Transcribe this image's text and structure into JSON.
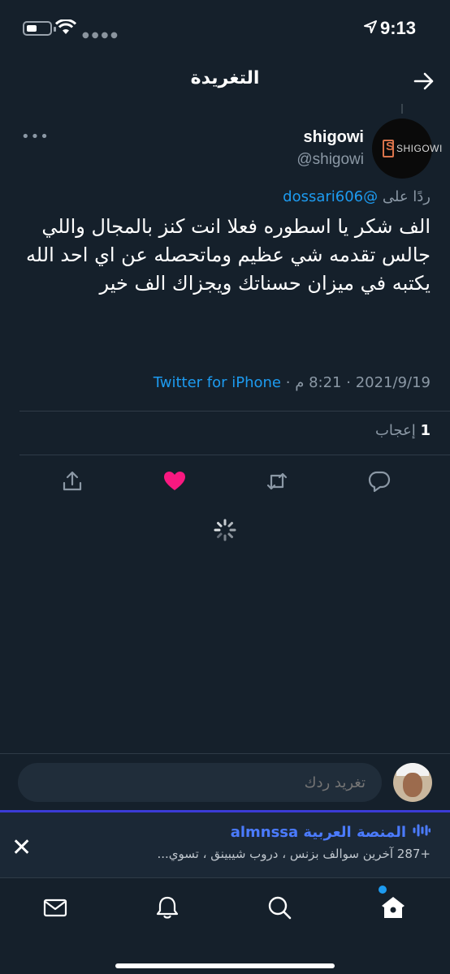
{
  "status_bar": {
    "time": "9:13"
  },
  "header": {
    "title": "التغريدة"
  },
  "tweet": {
    "author_name": "shigowi",
    "author_handle": "@shigowi",
    "avatar_text": "SHIGOWI",
    "avatar_letter": "S",
    "reply_to_prefix": "ردًا على ",
    "reply_to_handle": "@dossari606",
    "text": "الف شكر يا اسطوره فعلا انت كنز بالمجال واللي جالس تقدمه شي عظيم وماتحصله عن اي احد الله يكتبه في ميزان حسناتك ويجزاك الف خير",
    "date": "2021/9/19",
    "separator": "·",
    "time": "8:21 م",
    "source": "Twitter for iPhone",
    "likes_count": "1",
    "likes_label": "إعجاب"
  },
  "reply": {
    "placeholder": "تغريد ردك"
  },
  "spaces": {
    "title": "المنصة العربية almnssa",
    "subtitle": "+287 آخرين  سوالف بزنس ، دروب شيبينق ، تسوي..."
  },
  "colors": {
    "background": "#15202b",
    "accent": "#1d9bf0",
    "like": "#f91880",
    "spaces": "#4b7bff"
  },
  "icons": [
    "back-arrow-icon",
    "more-icon",
    "share-icon",
    "like-icon",
    "retweet-icon",
    "reply-icon",
    "loading-spinner-icon",
    "close-icon",
    "mail-icon",
    "bell-icon",
    "search-icon",
    "home-icon"
  ]
}
